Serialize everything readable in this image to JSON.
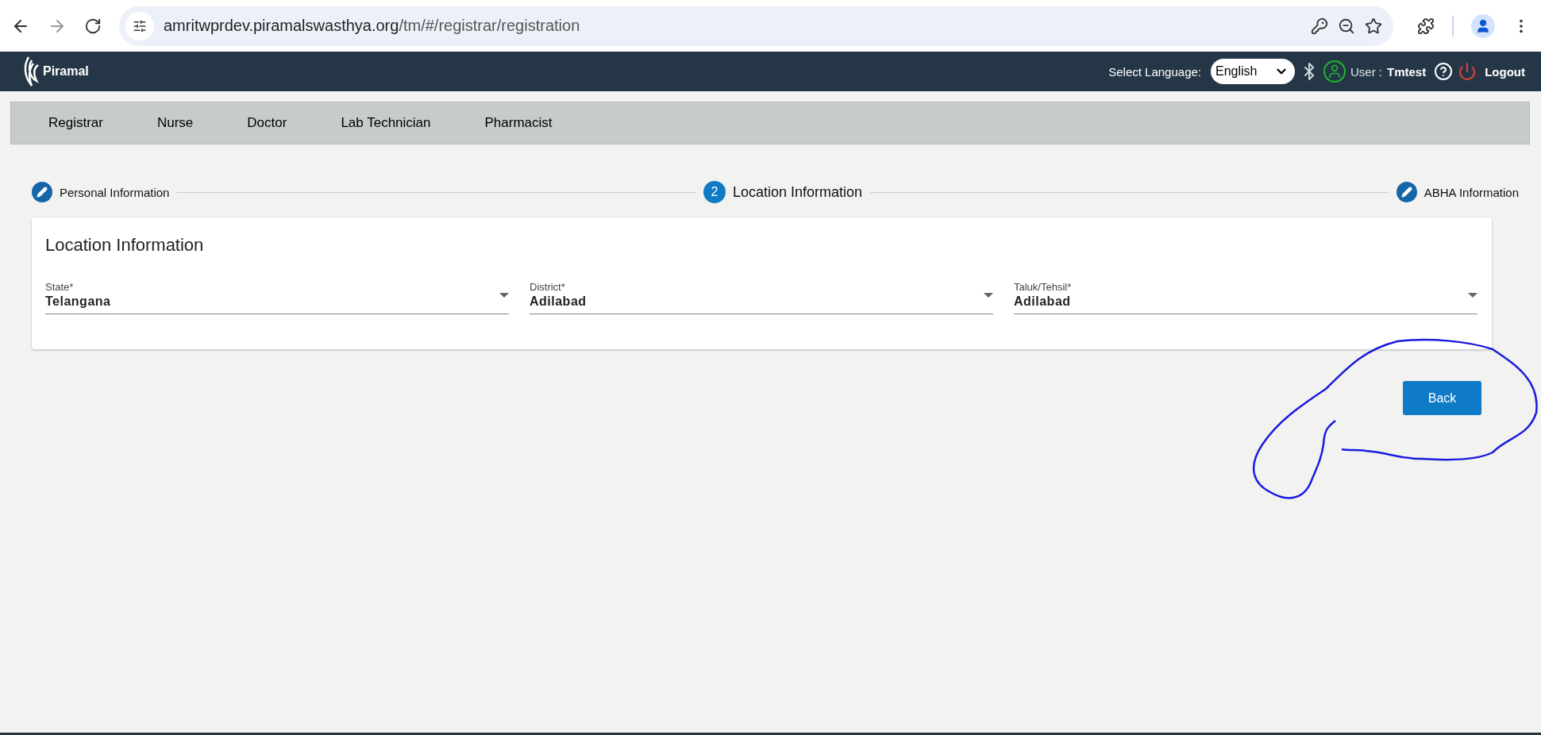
{
  "browser": {
    "url_host": "amritwprdev.piramalswasthya.org",
    "url_path": "/tm/#/registrar/registration"
  },
  "header": {
    "brand": "Piramal",
    "language_label": "Select Language:",
    "language": "English",
    "user_label": "User :",
    "user_name": "Tmtest",
    "logout": "Logout"
  },
  "menu": [
    "Registrar",
    "Nurse",
    "Doctor",
    "Lab Technician",
    "Pharmacist"
  ],
  "stepper": [
    {
      "label": "Personal Information",
      "kind": "edit",
      "selected": false
    },
    {
      "label": "Location Information",
      "kind": "number",
      "number": "2",
      "selected": true
    },
    {
      "label": "ABHA Information",
      "kind": "edit",
      "selected": false
    }
  ],
  "card": {
    "title": "Location Information",
    "fields": [
      {
        "label": "State*",
        "value": "Telangana"
      },
      {
        "label": "District*",
        "value": "Adilabad"
      },
      {
        "label": "Taluk/Tehsil*",
        "value": "Adilabad"
      }
    ]
  },
  "back_button": "Back"
}
